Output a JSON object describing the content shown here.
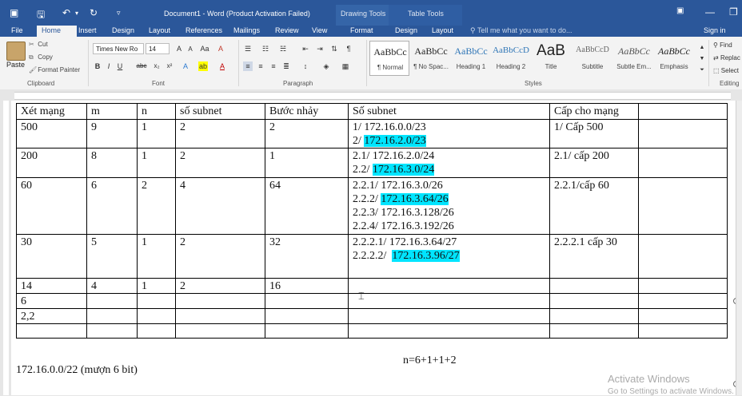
{
  "titlebar": {
    "document_title": "Document1 - Word (Product Activation Failed)",
    "contextual": [
      {
        "group": "Drawing Tools"
      },
      {
        "group": "Table Tools"
      }
    ]
  },
  "tabs": [
    "File",
    "Home",
    "Insert",
    "Design",
    "Layout",
    "References",
    "Mailings",
    "Review",
    "View",
    "Format",
    "Design",
    "Layout"
  ],
  "active_tab": "Home",
  "tell_me": "Tell me what you want to do...",
  "sign_in": "Sign in",
  "ribbon": {
    "clipboard": {
      "paste": "Paste",
      "cut": "Cut",
      "copy": "Copy",
      "format_painter": "Format Painter",
      "label": "Clipboard"
    },
    "font": {
      "name": "Times New Ro",
      "size": "14",
      "label": "Font"
    },
    "paragraph": {
      "label": "Paragraph"
    },
    "styles": {
      "label": "Styles",
      "items": [
        {
          "sample": "AaBbCc",
          "name": "¶ Normal"
        },
        {
          "sample": "AaBbCc",
          "name": "¶ No Spac..."
        },
        {
          "sample": "AaBbCc",
          "name": "Heading 1"
        },
        {
          "sample": "AaBbCcD",
          "name": "Heading 2"
        },
        {
          "sample": "AaB",
          "name": "Title"
        },
        {
          "sample": "AaBbCcD",
          "name": "Subtitle"
        },
        {
          "sample": "AaBbCc",
          "name": "Subtle Em..."
        },
        {
          "sample": "AaBbCc",
          "name": "Emphasis"
        }
      ]
    },
    "editing": {
      "find": "Find",
      "replace": "Replac",
      "select": "Select",
      "label": "Editing"
    }
  },
  "table": {
    "headers": [
      "Xét mạng",
      "m",
      "n",
      "số subnet",
      "Bước nhảy",
      "Số subnet",
      "Cấp cho mạng",
      ""
    ],
    "rows": [
      {
        "cells": [
          "500",
          "9",
          "1",
          "2",
          "2"
        ],
        "subnet_lines": [
          {
            "prefix": "1/ 172.16.0.0/23",
            "highlight": ""
          },
          {
            "prefix": "2/ ",
            "highlight": "172.16.2.0/23"
          }
        ],
        "assign": "1/ Cấp 500"
      },
      {
        "cells": [
          "200",
          "8",
          "1",
          "2",
          "1"
        ],
        "subnet_lines": [
          {
            "prefix": "2.1/ 172.16.2.0/24",
            "highlight": ""
          },
          {
            "prefix": "2.2/ ",
            "highlight": "172.16.3.0/24"
          }
        ],
        "assign": "2.1/ cấp 200"
      },
      {
        "cells": [
          "60",
          "6",
          "2",
          "4",
          "64"
        ],
        "subnet_lines": [
          {
            "prefix": "2.2.1/ 172.16.3.0/26",
            "highlight": ""
          },
          {
            "prefix": "2.2.2/ ",
            "highlight": "172.16.3.64/26"
          },
          {
            "prefix": "2.2.3/ 172.16.3.128/26",
            "highlight": ""
          },
          {
            "prefix": "2.2.4/ 172.16.3.192/26",
            "highlight": ""
          }
        ],
        "assign": "2.2.1/cấp 60"
      },
      {
        "cells": [
          "30",
          "5",
          "1",
          "2",
          "32"
        ],
        "subnet_lines": [
          {
            "prefix": "2.2.2.1/ 172.16.3.64/27",
            "highlight": ""
          },
          {
            "prefix": "2.2.2.2/  ",
            "highlight": "172.16.3.96/27"
          }
        ],
        "assign": "2.2.2.1 cấp 30"
      },
      {
        "cells": [
          "14",
          "4",
          "1",
          "2",
          "16"
        ],
        "subnet_lines": [],
        "assign": ""
      },
      {
        "cells": [
          "6",
          "",
          "",
          "",
          ""
        ],
        "subnet_lines": [],
        "assign": ""
      },
      {
        "cells": [
          "2,2",
          "",
          "",
          "",
          ""
        ],
        "subnet_lines": [],
        "assign": ""
      },
      {
        "cells": [
          "",
          "",
          "",
          "",
          ""
        ],
        "subnet_lines": [],
        "assign": ""
      }
    ]
  },
  "notes": {
    "left": "172.16.0.0/22 (mượn 6 bit)",
    "middle": "n=6+1+1+2"
  },
  "watermark": {
    "line1": "Activate Windows",
    "line2": "Go to Settings to activate Windows."
  },
  "colors": {
    "word_blue": "#2b579a",
    "highlight": "#00e5ff"
  }
}
